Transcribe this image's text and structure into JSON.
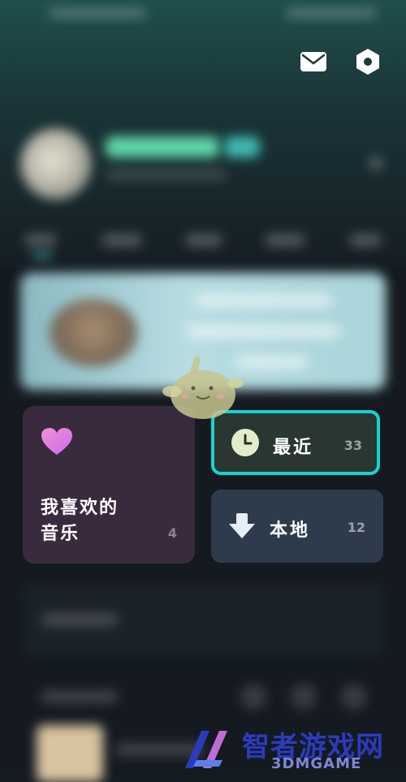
{
  "colors": {
    "accent_highlight": "#17d3d0",
    "like_card_bg": "#3a2a3d",
    "recent_card_bg": "#2a3632",
    "local_card_bg": "#2e3b4d",
    "watermark_blue": "#2b3bbd"
  },
  "header": {
    "mail_icon": "mail-icon",
    "settings_icon": "hexagon-settings-icon"
  },
  "cards": {
    "liked": {
      "icon": "heart-icon",
      "title": "我喜欢的\n音乐",
      "count": "4"
    },
    "recent": {
      "icon": "clock-icon",
      "label": "最近",
      "count": "33"
    },
    "local": {
      "icon": "download-icon",
      "label": "本地",
      "count": "12"
    }
  },
  "watermark": {
    "cn": "智者游戏网",
    "en": "3DMGAME"
  }
}
